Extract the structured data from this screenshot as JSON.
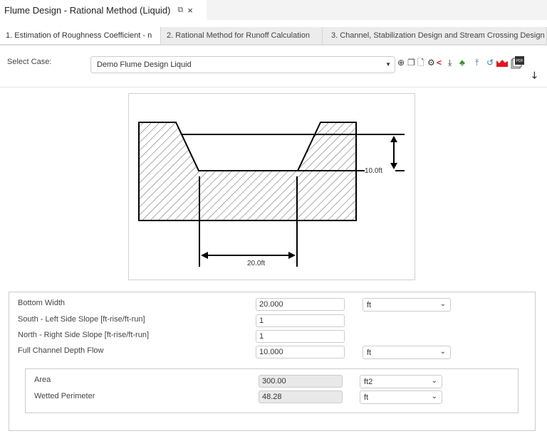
{
  "window": {
    "title": "Flume Design - Rational Method (Liquid)",
    "popout_icon": "popout-icon",
    "close_icon": "×"
  },
  "tabs": [
    {
      "label": "1. Estimation of Roughness Coefficient - n",
      "active": true
    },
    {
      "label": "2. Rational Method for Runoff Calculation"
    },
    {
      "label": "3. Channel, Stabilization Design and Stream Crossing Design"
    }
  ],
  "case": {
    "label": "Select Case:",
    "value": "Demo Flume Design Liquid"
  },
  "toolbar": {
    "icons": [
      "add-circle-icon",
      "copy-icon",
      "pdf-file-icon",
      "gear-icon",
      "share-icon",
      "download-icon",
      "hierarchy-icon",
      "upload-icon",
      "history-icon",
      "area-chart-icon",
      "pdf-stack-icon",
      "arrow-down-icon"
    ],
    "pdf_badge": "PDF"
  },
  "diagram": {
    "depth_label": "10.0ft",
    "width_label": "20.0ft"
  },
  "form": {
    "bottom_width": {
      "label": "Bottom Width",
      "value": "20.000",
      "unit": "ft"
    },
    "left_slope": {
      "label": "South - Left Side Slope [ft-rise/ft-run]",
      "value": "1"
    },
    "right_slope": {
      "label": "North - Right Side Slope [ft-rise/ft-run]",
      "value": "1"
    },
    "depth": {
      "label": "Full Channel Depth Flow",
      "value": "10.000",
      "unit": "ft"
    }
  },
  "results": {
    "area": {
      "label": "Area",
      "value": "300.00",
      "unit": "ft2"
    },
    "wetted_perimeter": {
      "label": "Wetted Perimeter",
      "value": "48.28",
      "unit": "ft"
    }
  },
  "colors": {
    "red": "#e8141b",
    "green": "#2a8a1f",
    "blue": "#2f7fc1"
  }
}
